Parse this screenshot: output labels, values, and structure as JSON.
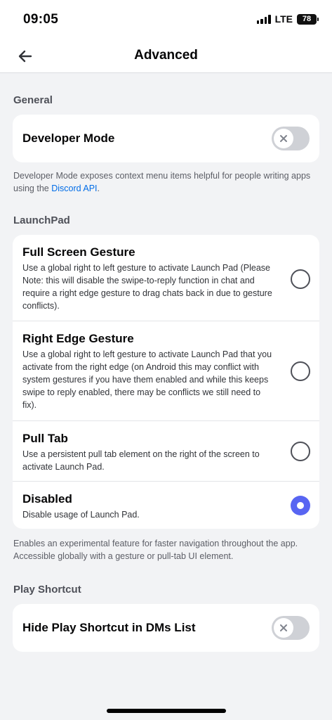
{
  "status_bar": {
    "time": "09:05",
    "network": "LTE",
    "battery": "78"
  },
  "nav": {
    "title": "Advanced",
    "back_icon": "arrow-left-icon"
  },
  "general": {
    "header": "General",
    "developer_mode": {
      "label": "Developer Mode",
      "enabled": false
    },
    "footnote_before_link": "Developer Mode exposes context menu items helpful for people writing apps using the ",
    "footnote_link": "Discord API",
    "footnote_after_link": "."
  },
  "launchpad": {
    "header": "LaunchPad",
    "options": [
      {
        "title": "Full Screen Gesture",
        "description": "Use a global right to left gesture to activate Launch Pad (Please Note: this will disable the swipe-to-reply function in chat and require a right edge gesture to drag chats back in due to gesture conflicts).",
        "selected": false
      },
      {
        "title": "Right Edge Gesture",
        "description": "Use a global right to left gesture to activate Launch Pad that you activate from the right edge (on Android this may conflict with system gestures if you have them enabled and while this keeps swipe to reply enabled, there may be conflicts we still need to fix).",
        "selected": false
      },
      {
        "title": "Pull Tab",
        "description": "Use a persistent pull tab element on the right of the screen to activate Launch Pad.",
        "selected": false
      },
      {
        "title": "Disabled",
        "description": "Disable usage of Launch Pad.",
        "selected": true
      }
    ],
    "footnote": "Enables an experimental feature for faster navigation throughout the app. Accessible globally with a gesture or pull-tab UI element."
  },
  "play_shortcut": {
    "header": "Play Shortcut",
    "hide_in_dms": {
      "label": "Hide Play Shortcut in DMs List",
      "enabled": false
    }
  },
  "colors": {
    "accent": "#5865f2",
    "link": "#006ce7",
    "toggle_off": "#cfd1d6"
  }
}
